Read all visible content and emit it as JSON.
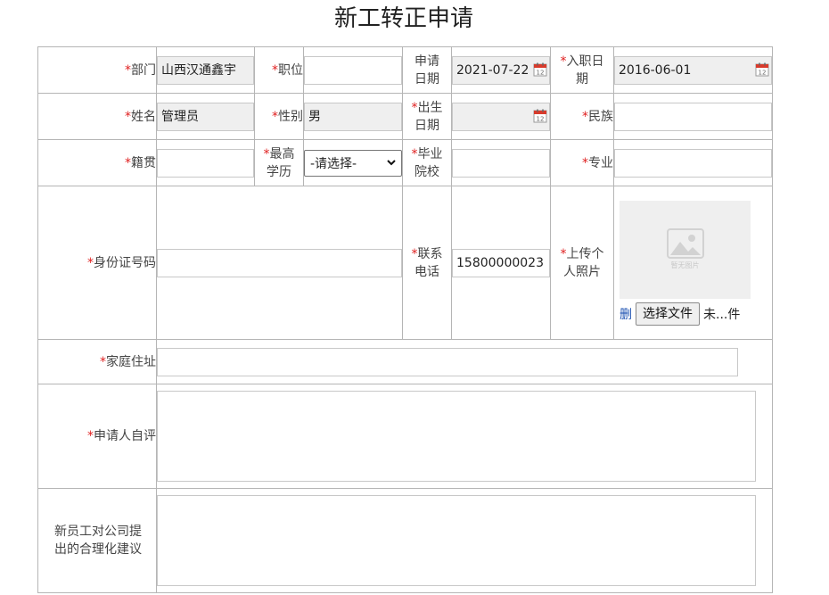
{
  "page": {
    "title": "新工转正申请"
  },
  "required_mark": "*",
  "colors": {
    "required": "#e02020",
    "border": "#b5b5b5",
    "readonly_bg": "#efefef",
    "link": "#1a4fb0"
  },
  "row1": {
    "department": {
      "label": "部门",
      "value": "山西汉通鑫宇"
    },
    "position": {
      "label": "职位",
      "value": ""
    },
    "apply_date": {
      "label_l1": "申请",
      "label_l2": "日期",
      "value": "2021-07-22"
    },
    "join_date": {
      "label_l1": "入职日",
      "label_l2": "期",
      "value": "2016-06-01"
    }
  },
  "row2": {
    "name": {
      "label": "姓名",
      "value": "管理员"
    },
    "gender": {
      "label": "性别",
      "value": "男"
    },
    "birth_date": {
      "label_l1": "出生",
      "label_l2": "日期",
      "value": ""
    },
    "ethnicity": {
      "label": "民族",
      "value": ""
    }
  },
  "row3": {
    "native_place": {
      "label": "籍贯",
      "value": ""
    },
    "education": {
      "label_l1": "最高",
      "label_l2": "学历",
      "selected": "-请选择-"
    },
    "school": {
      "label_l1": "毕业",
      "label_l2": "院校",
      "value": ""
    },
    "major": {
      "label": "专业",
      "value": ""
    }
  },
  "row4": {
    "id_number": {
      "label": "身份证号码",
      "value": ""
    },
    "phone": {
      "label_l1": "联系",
      "label_l2": "电话",
      "value": "15800000023"
    },
    "photo": {
      "label_l1": "上传个",
      "label_l2": "人照片",
      "placeholder_caption": "暂无图片",
      "delete_label": "删",
      "choose_file_label": "选择文件",
      "file_status": "未...件"
    }
  },
  "address": {
    "label": "家庭住址",
    "value": ""
  },
  "self_evaluation": {
    "label": "申请人自评"
  },
  "suggestion": {
    "label_l1": "新员工对公司提",
    "label_l2": "出的合理化建议"
  }
}
